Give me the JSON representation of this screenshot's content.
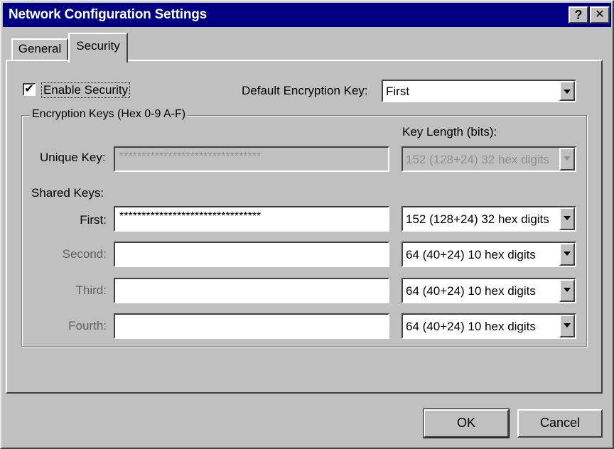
{
  "window": {
    "title": "Network Configuration Settings",
    "help_label": "?",
    "close_label": "✕"
  },
  "tabs": [
    {
      "label": "General",
      "active": false
    },
    {
      "label": "Security",
      "active": true
    }
  ],
  "security": {
    "enable_label": "Enable Security",
    "enable_checked": "✔",
    "default_key_label": "Default Encryption Key:",
    "default_key_value": "First",
    "group_title": "Encryption Keys (Hex 0-9 A-F)",
    "key_length_label": "Key Length (bits):",
    "unique_key": {
      "label": "Unique Key:",
      "value": "********************************",
      "length": "152 (128+24) 32 hex digits"
    },
    "shared_keys_label": "Shared Keys:",
    "shared_keys": [
      {
        "label": "First:",
        "value": "********************************",
        "length": "152 (128+24) 32 hex digits"
      },
      {
        "label": "Second:",
        "value": "",
        "length": "64  (40+24)  10 hex digits"
      },
      {
        "label": "Third:",
        "value": "",
        "length": "64  (40+24)  10 hex digits"
      },
      {
        "label": "Fourth:",
        "value": "",
        "length": "64  (40+24)  10 hex digits"
      }
    ]
  },
  "buttons": {
    "ok": "OK",
    "cancel": "Cancel"
  }
}
